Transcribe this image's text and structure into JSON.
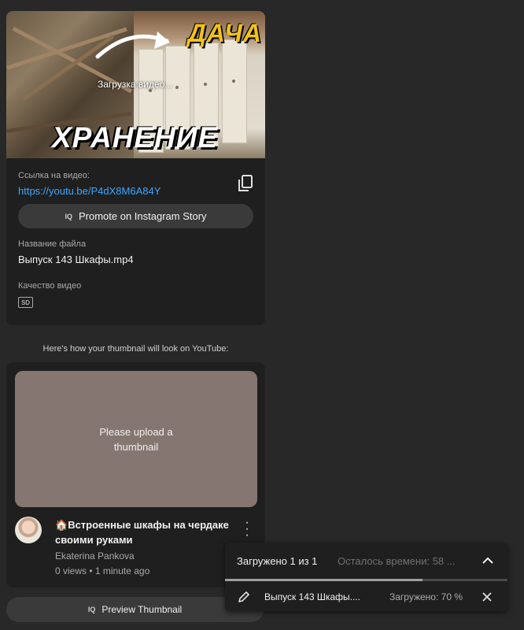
{
  "video_card": {
    "thumbnail_word_top": "ДАЧА",
    "thumbnail_word_bottom": "ХРАНЕНИЕ",
    "thumbnail_status": "Загрузка видео...",
    "link_label": "Ссылка на видео:",
    "link_url": "https://youtu.be/P4dX8M6A84Y",
    "promote_button": "Promote on Instagram Story",
    "promote_icon_text": "IQ",
    "filename_label": "Название файла",
    "filename": "Выпуск 143 Шкафы.mp4",
    "quality_label": "Качество видео",
    "quality_badge": "SD"
  },
  "preview": {
    "caption": "Here's how your thumbnail will look on YouTube:",
    "placeholder_text": "Please upload a thumbnail",
    "title_emoji": "🏠",
    "title": "Встроенные шкафы на чердаке своими руками",
    "channel": "Ekaterina Pankova",
    "meta": "0 views • 1 minute ago",
    "button": "Preview Thumbnail",
    "button_icon_text": "IQ"
  },
  "upload_panel": {
    "header": "Загружено 1 из 1",
    "remaining": "Осталось времени: 58 ...",
    "file": "Выпуск 143 Шкафы....",
    "status": "Загружено: 70 %",
    "progress": 0.7
  },
  "colors": {
    "background": "#282828",
    "card": "#1f1f1f",
    "link": "#3ea6ff",
    "placeholder": "#857672",
    "thumbnail_accent": "#f3c21a"
  },
  "icons": [
    "copy-icon",
    "sd-icon",
    "more-vert-icon",
    "chevron-up-icon",
    "pencil-icon",
    "close-icon",
    "arrow-icon"
  ]
}
